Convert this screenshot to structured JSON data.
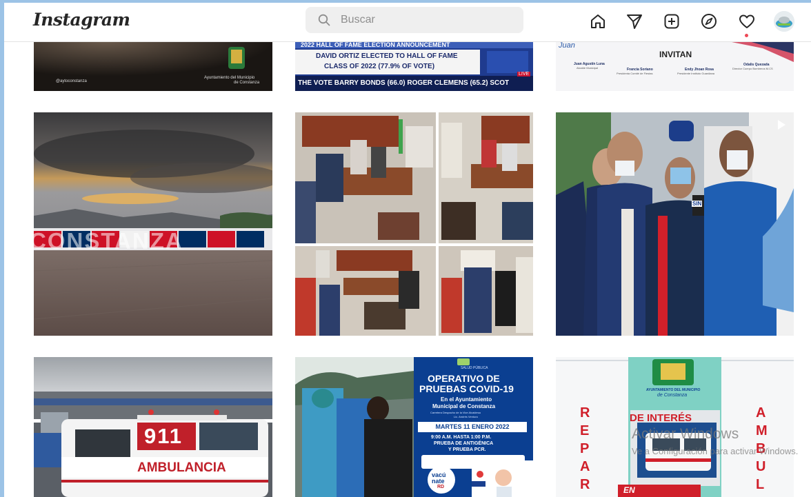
{
  "header": {
    "logo": "Instagram",
    "search_placeholder": "Buscar",
    "icons": [
      "home-icon",
      "direct-message-icon",
      "new-post-icon",
      "explore-icon",
      "activity-heart-icon",
      "profile-avatar"
    ]
  },
  "posts": {
    "row1": {
      "p1": {
        "footer_left": "@aytoconstanza",
        "footer_right_1": "Ayuntamiento del Municipio",
        "footer_right_2": "de Constanza"
      },
      "p2": {
        "banner": "2022 HALL OF FAME ELECTION ANNOUNCEMENT",
        "line1": "DAVID ORTIZ ELECTED TO HALL OF FAME",
        "line2": "CLASS OF 2022 (77.9% OF VOTE)",
        "ticker": "THE VOTE  BARRY BONDS (66.0) ROGER CLEMENS (65.2) SCOT",
        "badge": "LIVE"
      },
      "p3": {
        "script": "Juan",
        "title": "INVITAN",
        "names": [
          {
            "name": "Juan Agustín Luna",
            "role": "Alcalde Municipal"
          },
          {
            "name": "Francia Soriano",
            "role": "Presidenta Comité de Fiestas"
          },
          {
            "name": "Endy Jhoan Rosa",
            "role": "Presidente Instituto Guardiana"
          },
          {
            "name": "Odalis Quezada",
            "role": "Director Cuerpo Bomberos M.CS"
          }
        ]
      }
    },
    "row2": {
      "p4": {
        "sign": "CONSTANZA"
      },
      "p5": {
        "description": "meeting collage"
      },
      "p6": {
        "mic_label": "SIN"
      }
    },
    "row3": {
      "p7": {
        "plate": "911",
        "label": "AMBULANCIA"
      },
      "p8": {
        "header_small": "SALUD PÚBLICA",
        "title_1": "OPERATIVO DE",
        "title_2": "PRUEBAS COVID-19",
        "sub_1": "En el Ayuntamiento",
        "sub_2": "Municipal de Constanza",
        "sub_3": "Carretera Despacho de la Vice Alcaldesa",
        "sub_4": "Lic. Andrés Ventura",
        "date": "MARTES 11 ENERO 2022",
        "hours": "9:00 A.M. HASTA 1:00 P.M.",
        "test_1": "PRUEBA DE ANTIGÉNICA",
        "test_2": "Y PRUEBA PCR.",
        "vac_1": "vacú",
        "vac_2": "nate",
        "vac_3": "RD"
      },
      "p9": {
        "org_1": "AYUNTAMIENTO DEL MUNICIPIO",
        "org_2": "de Constanza",
        "heading": "DE INTERÉS",
        "left_word": [
          "R",
          "E",
          "P",
          "A",
          "R"
        ],
        "right_word": [
          "A",
          "M",
          "B",
          "U",
          "L"
        ],
        "bottom": "EN"
      }
    }
  },
  "watermark": {
    "title": "Activar Windows",
    "subtitle": "Ve a Configuración para activar Windows."
  },
  "colors": {
    "ig_red": "#ed4956",
    "flag_red": "#ce1126",
    "flag_blue": "#002d62",
    "covid_blue": "#0b3f91"
  }
}
